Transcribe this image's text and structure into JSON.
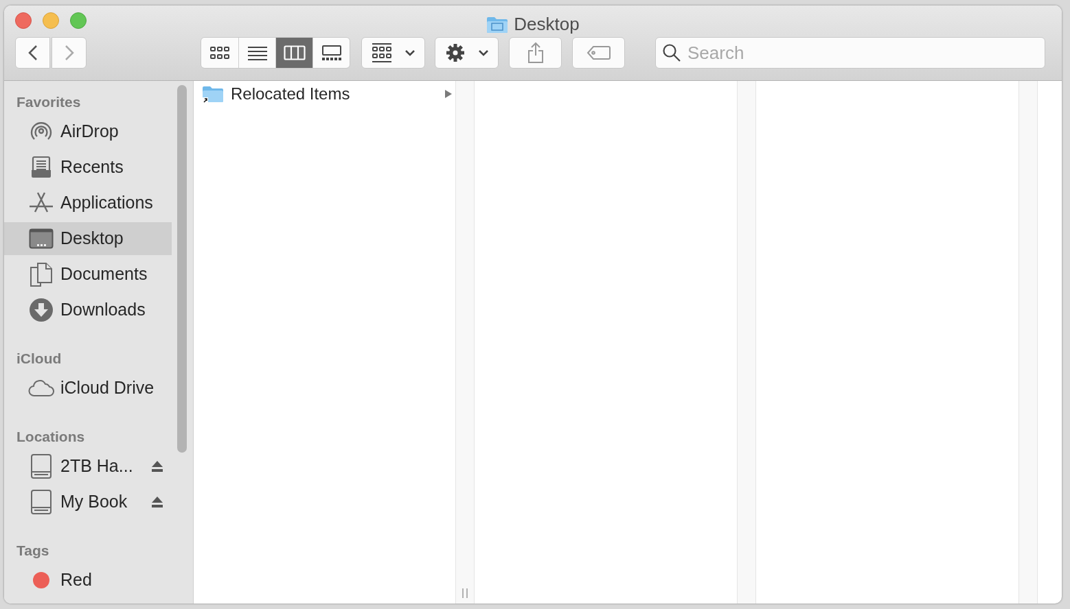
{
  "window": {
    "title": "Desktop"
  },
  "toolbar": {
    "view_modes": [
      {
        "kind": "icons",
        "selected": false
      },
      {
        "kind": "list",
        "selected": false
      },
      {
        "kind": "columns",
        "selected": true
      },
      {
        "kind": "gallery",
        "selected": false
      }
    ],
    "search": {
      "placeholder": "Search"
    }
  },
  "sidebar": {
    "sections": [
      {
        "heading": "Favorites",
        "items": [
          {
            "label": "AirDrop",
            "kind": "airdrop",
            "selected": false
          },
          {
            "label": "Recents",
            "kind": "recents",
            "selected": false
          },
          {
            "label": "Applications",
            "kind": "applications",
            "selected": false
          },
          {
            "label": "Desktop",
            "kind": "desktop",
            "selected": true
          },
          {
            "label": "Documents",
            "kind": "documents",
            "selected": false
          },
          {
            "label": "Downloads",
            "kind": "downloads",
            "selected": false
          }
        ]
      },
      {
        "heading": "iCloud",
        "items": [
          {
            "label": "iCloud Drive",
            "kind": "cloud",
            "selected": false
          }
        ]
      },
      {
        "heading": "Locations",
        "items": [
          {
            "label": "2TB Ha...",
            "kind": "disk",
            "selected": false,
            "ejectable": true
          },
          {
            "label": "My Book",
            "kind": "disk",
            "selected": false,
            "ejectable": true
          }
        ]
      },
      {
        "heading": "Tags",
        "items": [
          {
            "label": "Red",
            "kind": "tag",
            "selected": false,
            "color": "#ec5f57"
          }
        ]
      }
    ]
  },
  "browser": {
    "column_1": [
      {
        "name": "Relocated Items",
        "kind": "folder_alias",
        "has_children": true
      }
    ]
  }
}
